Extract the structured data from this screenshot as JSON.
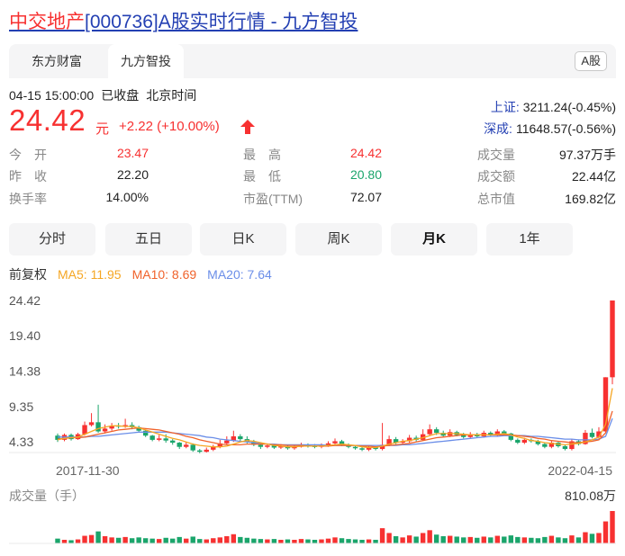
{
  "title": {
    "name": "中交地产",
    "code": "[000736]",
    "rest": "A股实时行情 - 九方智投"
  },
  "tabs": {
    "items": [
      "东方财富",
      "九方智投"
    ],
    "badge": "A股"
  },
  "status": {
    "datetime": "04-15 15:00:00",
    "state": "已收盘",
    "tz": "北京时间"
  },
  "quote": {
    "price": "24.42",
    "unit": "元",
    "change": "+2.22 (+10.00%)"
  },
  "indices": [
    {
      "name": "上证:",
      "value": "3211.24(-0.45%)"
    },
    {
      "name": "深成:",
      "value": "11648.57(-0.56%)"
    }
  ],
  "stats": [
    {
      "label": "今　开",
      "value": "23.47",
      "color": "#f73131"
    },
    {
      "label": "最　高",
      "value": "24.42",
      "color": "#f73131"
    },
    {
      "label": "成交量",
      "value": "97.37万手",
      "color": "#222222"
    },
    {
      "label": "昨　收",
      "value": "22.20",
      "color": "#222222"
    },
    {
      "label": "最　低",
      "value": "20.80",
      "color": "#1aa56b"
    },
    {
      "label": "成交额",
      "value": "22.44亿",
      "color": "#222222"
    },
    {
      "label": "换手率",
      "value": "14.00%",
      "color": "#222222"
    },
    {
      "label": "市盈(TTM)",
      "value": "72.07",
      "color": "#222222"
    },
    {
      "label": "总市值",
      "value": "169.82亿",
      "color": "#222222"
    }
  ],
  "periods": {
    "items": [
      "分时",
      "五日",
      "日K",
      "周K",
      "月K",
      "1年"
    ],
    "active": "月K"
  },
  "legend": {
    "adj": "前复权",
    "ma5": "MA5: 11.95",
    "ma10": "MA10: 8.69",
    "ma20": "MA20: 7.64",
    "ma5_color": "#f5a623",
    "ma10_color": "#f0622b",
    "ma20_color": "#6b8ee8"
  },
  "chart_data": {
    "type": "candlestick",
    "y_ticks": [
      "24.42",
      "19.40",
      "14.38",
      "9.35",
      "4.33"
    ],
    "y_tick_values": [
      24.42,
      19.4,
      14.38,
      9.35,
      4.33
    ],
    "x_labels": [
      "2017-11-30",
      "2022-04-15"
    ],
    "volume_label": "成交量（手）",
    "volume_max_label": "810.08万",
    "up_color": "#f73131",
    "down_color": "#1aa56b",
    "candles": [
      [
        5.2,
        4.6,
        5.5,
        4.3
      ],
      [
        4.6,
        5.3,
        5.5,
        4.4
      ],
      [
        5.3,
        4.7,
        5.5,
        4.5
      ],
      [
        4.7,
        5.4,
        5.6,
        4.6
      ],
      [
        5.4,
        6.7,
        7.2,
        5.2
      ],
      [
        6.7,
        7.1,
        8.4,
        6.5
      ],
      [
        7.1,
        5.8,
        9.6,
        5.6
      ],
      [
        5.8,
        6.2,
        6.8,
        5.5
      ],
      [
        6.2,
        6.6,
        7.0,
        5.9
      ],
      [
        6.6,
        6.5,
        7.0,
        6.2
      ],
      [
        6.5,
        6.7,
        7.6,
        6.3
      ],
      [
        6.7,
        6.4,
        7.1,
        6.1
      ],
      [
        6.4,
        5.9,
        6.6,
        5.7
      ],
      [
        5.9,
        5.2,
        6.0,
        5.0
      ],
      [
        5.2,
        4.6,
        5.3,
        4.4
      ],
      [
        4.6,
        4.8,
        5.3,
        4.4
      ],
      [
        4.8,
        4.5,
        5.4,
        4.2
      ],
      [
        4.5,
        4.2,
        4.7,
        3.9
      ],
      [
        4.2,
        3.6,
        4.3,
        3.3
      ],
      [
        3.6,
        3.9,
        4.3,
        3.4
      ],
      [
        3.9,
        3.1,
        4.1,
        2.9
      ],
      [
        3.1,
        2.9,
        3.3,
        2.7
      ],
      [
        2.9,
        3.2,
        3.5,
        2.8
      ],
      [
        3.2,
        3.6,
        3.9,
        3.0
      ],
      [
        3.6,
        4.1,
        4.6,
        3.4
      ],
      [
        4.1,
        4.5,
        5.1,
        3.9
      ],
      [
        4.5,
        5.1,
        5.9,
        4.3
      ],
      [
        5.1,
        4.7,
        5.4,
        4.4
      ],
      [
        4.7,
        4.3,
        5.1,
        4.1
      ],
      [
        4.3,
        3.9,
        4.6,
        3.7
      ],
      [
        3.9,
        3.6,
        4.2,
        3.3
      ],
      [
        3.6,
        3.8,
        4.1,
        3.4
      ],
      [
        3.8,
        3.5,
        4.0,
        3.3
      ],
      [
        3.5,
        3.7,
        4.0,
        3.3
      ],
      [
        3.7,
        3.4,
        3.9,
        3.2
      ],
      [
        3.4,
        3.6,
        3.8,
        3.2
      ],
      [
        3.6,
        3.9,
        4.2,
        3.5
      ],
      [
        3.9,
        3.7,
        4.1,
        3.5
      ],
      [
        3.7,
        3.6,
        4.0,
        3.4
      ],
      [
        3.6,
        3.8,
        4.1,
        3.4
      ],
      [
        3.8,
        4.1,
        4.4,
        3.6
      ],
      [
        4.1,
        4.4,
        4.8,
        3.9
      ],
      [
        4.4,
        3.9,
        4.6,
        3.7
      ],
      [
        3.9,
        3.6,
        4.1,
        3.4
      ],
      [
        3.6,
        3.4,
        3.8,
        3.2
      ],
      [
        3.4,
        3.2,
        3.6,
        3.0
      ],
      [
        3.2,
        3.5,
        3.8,
        3.0
      ],
      [
        3.5,
        3.3,
        3.7,
        3.1
      ],
      [
        3.3,
        3.9,
        7.0,
        3.1
      ],
      [
        3.9,
        4.7,
        5.2,
        3.7
      ],
      [
        4.7,
        4.2,
        5.0,
        4.0
      ],
      [
        4.2,
        4.4,
        4.7,
        4.0
      ],
      [
        4.4,
        4.9,
        5.3,
        4.2
      ],
      [
        4.9,
        4.6,
        5.2,
        4.4
      ],
      [
        4.6,
        5.4,
        6.1,
        4.5
      ],
      [
        5.4,
        6.1,
        6.8,
        5.2
      ],
      [
        6.1,
        5.6,
        6.4,
        5.3
      ],
      [
        5.6,
        5.2,
        5.9,
        5.0
      ],
      [
        5.2,
        5.7,
        6.1,
        5.0
      ],
      [
        5.7,
        5.3,
        5.9,
        5.1
      ],
      [
        5.3,
        5.0,
        5.6,
        4.8
      ],
      [
        5.0,
        5.4,
        5.7,
        4.8
      ],
      [
        5.4,
        5.1,
        5.6,
        4.9
      ],
      [
        5.1,
        5.6,
        5.9,
        4.9
      ],
      [
        5.6,
        5.3,
        5.8,
        5.1
      ],
      [
        5.3,
        5.8,
        6.1,
        5.1
      ],
      [
        5.8,
        5.5,
        6.0,
        5.3
      ],
      [
        5.5,
        4.6,
        5.6,
        4.4
      ],
      [
        4.6,
        4.2,
        4.8,
        4.0
      ],
      [
        4.2,
        4.6,
        4.9,
        4.0
      ],
      [
        4.6,
        4.4,
        4.8,
        4.2
      ],
      [
        4.4,
        4.0,
        4.6,
        3.8
      ],
      [
        4.0,
        3.6,
        4.2,
        3.4
      ],
      [
        3.6,
        4.2,
        4.5,
        3.4
      ],
      [
        4.2,
        3.7,
        4.3,
        3.5
      ],
      [
        3.7,
        3.3,
        3.9,
        3.1
      ],
      [
        3.3,
        4.4,
        4.7,
        3.1
      ],
      [
        4.4,
        4.0,
        4.6,
        3.8
      ],
      [
        4.0,
        5.6,
        6.0,
        3.9
      ],
      [
        5.6,
        5.0,
        6.2,
        4.8
      ],
      [
        5.0,
        5.8,
        6.4,
        4.8
      ],
      [
        5.8,
        13.5,
        13.5,
        5.6
      ],
      [
        13.5,
        24.42,
        24.42,
        12.5
      ]
    ],
    "ma5": [
      4.6,
      4.8,
      4.9,
      5.0,
      5.4,
      5.8,
      6.2,
      6.4,
      6.6,
      6.6,
      6.5,
      6.5,
      6.3,
      6.0,
      5.7,
      5.4,
      5.1,
      4.8,
      4.6,
      4.3,
      4.0,
      3.8,
      3.7,
      3.6,
      3.6,
      3.7,
      4.0,
      4.3,
      4.5,
      4.4,
      4.2,
      4.0,
      3.8,
      3.7,
      3.6,
      3.6,
      3.7,
      3.7,
      3.7,
      3.7,
      3.8,
      3.9,
      4.0,
      3.9,
      3.8,
      3.6,
      3.5,
      3.5,
      3.7,
      4.0,
      4.2,
      4.4,
      4.5,
      4.7,
      4.9,
      5.2,
      5.5,
      5.5,
      5.5,
      5.5,
      5.4,
      5.3,
      5.3,
      5.3,
      5.3,
      5.4,
      5.5,
      5.3,
      5.0,
      4.8,
      4.5,
      4.4,
      4.2,
      4.1,
      4.0,
      3.9,
      4.0,
      4.1,
      4.3,
      4.6,
      5.0,
      6.8,
      11.95
    ],
    "ma10": [
      4.7,
      4.8,
      4.9,
      4.9,
      5.0,
      5.2,
      5.4,
      5.6,
      5.8,
      6.0,
      6.1,
      6.2,
      6.3,
      6.2,
      6.1,
      6.0,
      5.8,
      5.6,
      5.4,
      5.1,
      4.9,
      4.6,
      4.4,
      4.2,
      4.0,
      3.9,
      3.9,
      3.9,
      4.0,
      4.0,
      4.0,
      4.0,
      3.9,
      3.9,
      3.8,
      3.8,
      3.8,
      3.7,
      3.7,
      3.7,
      3.7,
      3.8,
      3.8,
      3.8,
      3.8,
      3.7,
      3.7,
      3.6,
      3.7,
      3.8,
      3.9,
      4.0,
      4.1,
      4.3,
      4.5,
      4.7,
      4.9,
      5.0,
      5.1,
      5.2,
      5.3,
      5.3,
      5.3,
      5.3,
      5.3,
      5.3,
      5.3,
      5.3,
      5.2,
      5.1,
      5.0,
      4.8,
      4.7,
      4.5,
      4.4,
      4.3,
      4.2,
      4.2,
      4.3,
      4.4,
      4.6,
      5.6,
      8.69
    ],
    "ma20": [
      5.0,
      5.0,
      5.0,
      5.0,
      5.0,
      5.1,
      5.1,
      5.2,
      5.3,
      5.4,
      5.5,
      5.6,
      5.7,
      5.7,
      5.7,
      5.7,
      5.7,
      5.6,
      5.5,
      5.4,
      5.3,
      5.2,
      5.0,
      4.9,
      4.7,
      4.6,
      4.5,
      4.4,
      4.3,
      4.2,
      4.1,
      4.0,
      4.0,
      3.9,
      3.9,
      3.9,
      3.9,
      3.9,
      3.9,
      3.9,
      3.8,
      3.8,
      3.8,
      3.8,
      3.8,
      3.8,
      3.8,
      3.8,
      3.8,
      3.8,
      3.8,
      3.9,
      3.9,
      4.0,
      4.1,
      4.2,
      4.3,
      4.4,
      4.5,
      4.6,
      4.7,
      4.8,
      4.9,
      5.0,
      5.1,
      5.1,
      5.2,
      5.2,
      5.2,
      5.2,
      5.1,
      5.1,
      5.0,
      4.9,
      4.8,
      4.7,
      4.7,
      4.6,
      4.6,
      4.6,
      4.7,
      5.1,
      7.64
    ],
    "volumes": [
      120,
      90,
      80,
      100,
      190,
      210,
      300,
      180,
      150,
      140,
      160,
      130,
      150,
      130,
      120,
      110,
      140,
      120,
      160,
      120,
      170,
      110,
      100,
      130,
      150,
      180,
      230,
      160,
      140,
      120,
      110,
      100,
      110,
      90,
      100,
      90,
      110,
      100,
      90,
      100,
      120,
      150,
      130,
      110,
      100,
      90,
      100,
      90,
      380,
      260,
      180,
      150,
      200,
      170,
      260,
      330,
      220,
      180,
      190,
      170,
      150,
      160,
      140,
      170,
      150,
      190,
      170,
      200,
      160,
      150,
      140,
      130,
      160,
      190,
      150,
      130,
      200,
      150,
      280,
      240,
      260,
      550,
      810
    ]
  }
}
